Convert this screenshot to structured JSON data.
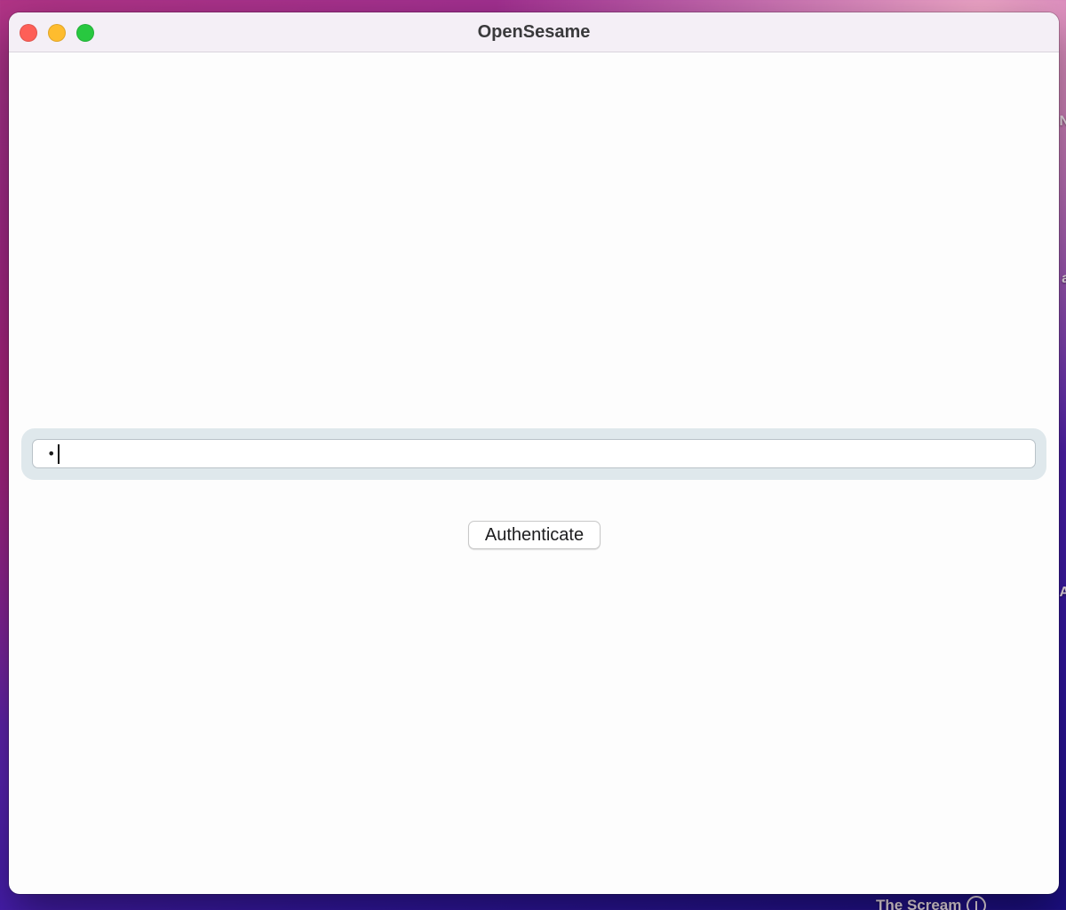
{
  "window": {
    "title": "OpenSesame"
  },
  "password_field": {
    "value_masked": "•",
    "is_focused": true
  },
  "authenticate_button": {
    "label": "Authenticate"
  },
  "desktop": {
    "edge_labels": [
      "N",
      "a",
      "A"
    ],
    "bottom_item_label": "The Scream"
  },
  "colors": {
    "close": "#fe5f57",
    "minimize": "#febc2e",
    "zoom": "#28c840",
    "focus_ring": "#dfe8ec"
  },
  "icons": {
    "bottom_item": "cloud-download-icon"
  }
}
